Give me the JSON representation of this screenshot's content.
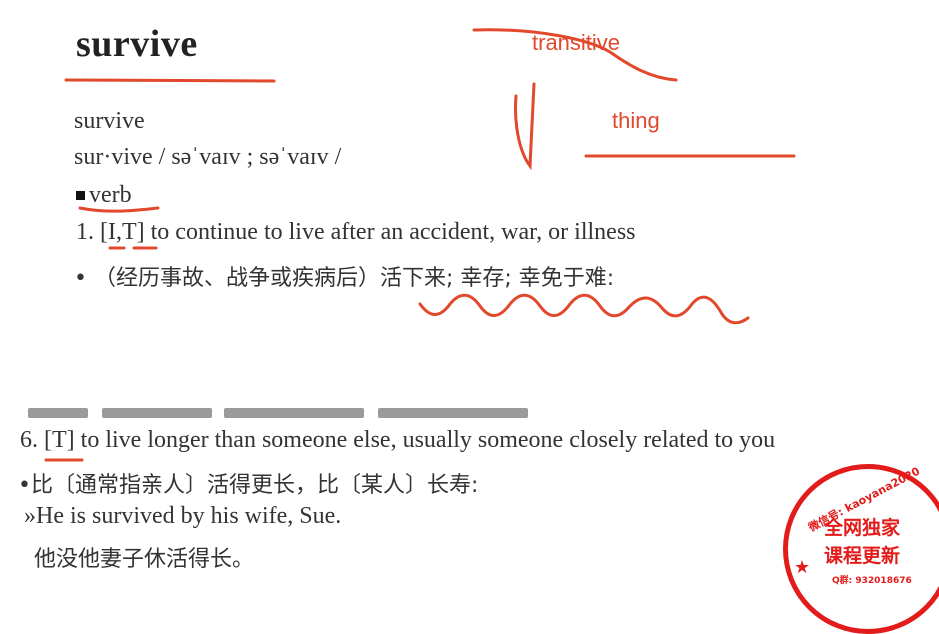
{
  "heading": {
    "title": "survive"
  },
  "entry": {
    "headword": "survive",
    "pronunciation": "sur·vive / səˈvaɪv ; səˈvaɪv /",
    "pos": "verb"
  },
  "sense1": {
    "number": "1.",
    "codes": "[I,T]",
    "definition": "to continue to live after an accident, war, or illness",
    "translation": "• （经历事故、战争或疾病后）活下来; 幸存; 幸免于难:"
  },
  "sense6": {
    "number": "6.",
    "codes": "[T]",
    "definition": "to live longer than someone else, usually someone closely related to you",
    "translation": "•比〔通常指亲人〕活得更长，比〔某人〕长寿:",
    "example": "»He is survived by his wife, Sue.",
    "example_translation": "他没他妻子休活得长。"
  },
  "annotations": {
    "transitive": "transitive",
    "thing": "thing",
    "color": "#e2482b"
  },
  "stamp": {
    "arc_text": "微信号: kaoyana2020",
    "line1": "全网独家",
    "line2": "课程更新",
    "qq": "Q群: 932018676",
    "color": "#e21b1b"
  }
}
